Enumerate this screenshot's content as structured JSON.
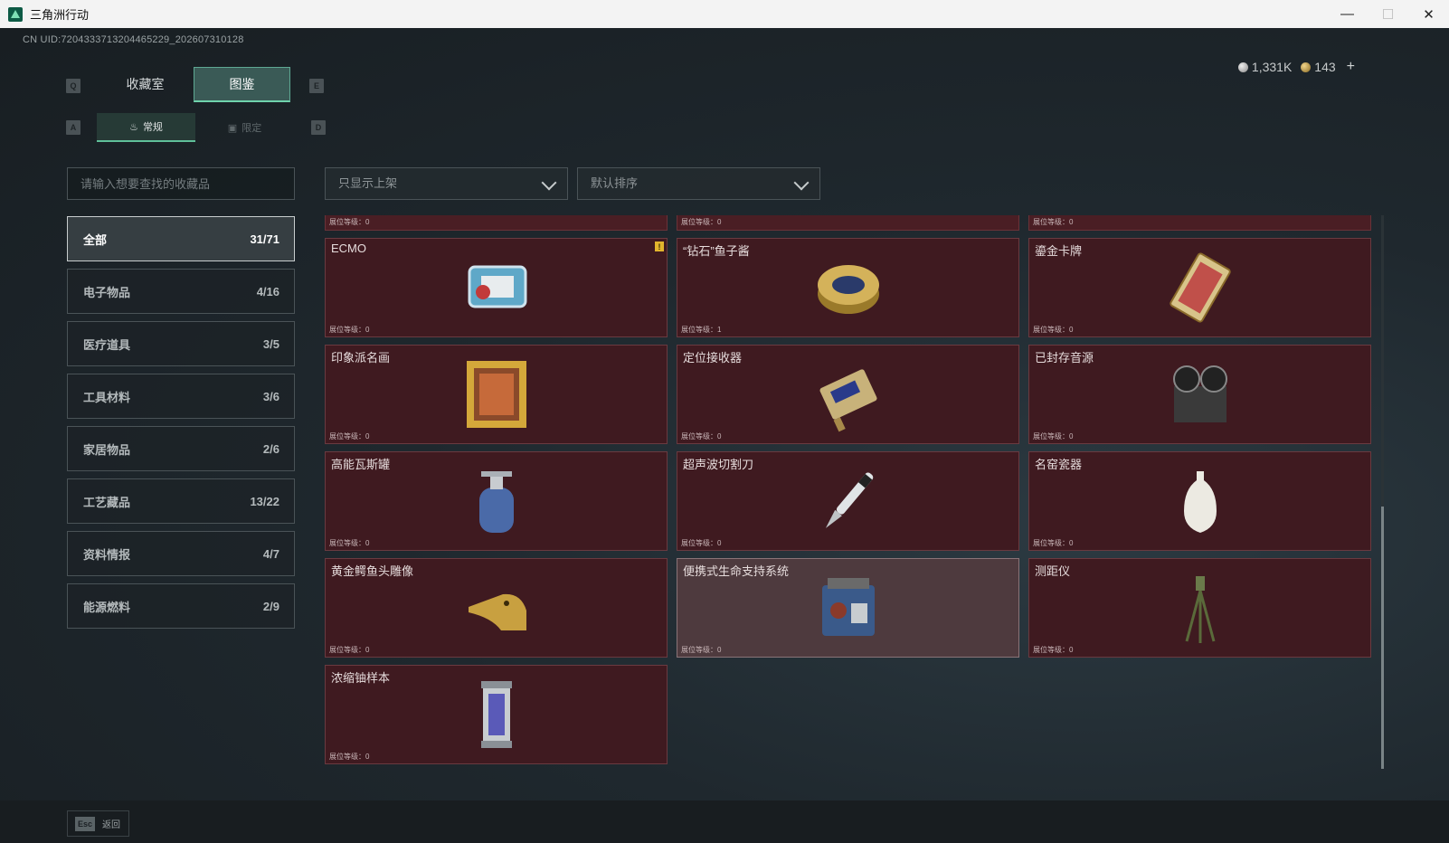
{
  "window": {
    "title": "三角洲行动",
    "controls": [
      "—",
      "☐",
      "✕"
    ]
  },
  "uid": "CN UID:7204333713204465229_202607310128",
  "currency": {
    "silver": "1,331K",
    "gold": "143",
    "plus": "+"
  },
  "keys": {
    "q": "Q",
    "e": "E",
    "a": "A",
    "d": "D"
  },
  "tabs": [
    {
      "label": "收藏室",
      "active": false
    },
    {
      "label": "图鉴",
      "active": true
    }
  ],
  "subtabs": [
    {
      "label": "常规",
      "icon": "flame-icon",
      "active": true
    },
    {
      "label": "限定",
      "icon": "frame-icon",
      "active": false
    }
  ],
  "search": {
    "placeholder": "请输入想要查找的收藏品",
    "value": ""
  },
  "filters": {
    "shelf": "只显示上架",
    "sort": "默认排序"
  },
  "categories": [
    {
      "label": "全部",
      "count": "31/71",
      "active": true
    },
    {
      "label": "电子物品",
      "count": "4/16"
    },
    {
      "label": "医疗道具",
      "count": "3/5"
    },
    {
      "label": "工具材料",
      "count": "3/6"
    },
    {
      "label": "家居物品",
      "count": "2/6"
    },
    {
      "label": "工艺藏品",
      "count": "13/22"
    },
    {
      "label": "资料情报",
      "count": "4/7"
    },
    {
      "label": "能源燃料",
      "count": "2/9"
    }
  ],
  "partial_row": [
    {
      "level": "展位等级：0"
    },
    {
      "level": "展位等级：0"
    },
    {
      "level": "展位等级：0"
    }
  ],
  "items": [
    {
      "name": "ECMO",
      "level": "展位等级：0",
      "icon": "ecmo-machine-icon",
      "badge": "!"
    },
    {
      "name": "“钻石”鱼子酱",
      "level": "展位等级：1",
      "icon": "caviar-tin-icon"
    },
    {
      "name": "鎏金卡牌",
      "level": "展位等级：0",
      "icon": "gilded-card-icon"
    },
    {
      "name": "印象派名画",
      "level": "展位等级：0",
      "icon": "framed-painting-icon"
    },
    {
      "name": "定位接收器",
      "level": "展位等级：0",
      "icon": "gps-receiver-icon"
    },
    {
      "name": "已封存音源",
      "level": "展位等级：0",
      "icon": "reel-recorder-icon"
    },
    {
      "name": "高能瓦斯罐",
      "level": "展位等级：0",
      "icon": "gas-canister-icon"
    },
    {
      "name": "超声波切割刀",
      "level": "展位等级：0",
      "icon": "ultrasonic-cutter-icon"
    },
    {
      "name": "名窑瓷器",
      "level": "展位等级：0",
      "icon": "porcelain-vase-icon"
    },
    {
      "name": "黄金鳄鱼头雕像",
      "level": "展位等级：0",
      "icon": "gold-crocodile-icon"
    },
    {
      "name": "便携式生命支持系统",
      "level": "展位等级：0",
      "icon": "life-support-icon",
      "highlight": true
    },
    {
      "name": "测距仪",
      "level": "展位等级：0",
      "icon": "rangefinder-icon"
    },
    {
      "name": "浓缩铀样本",
      "level": "展位等级：0",
      "icon": "uranium-canister-icon"
    }
  ],
  "footer": {
    "key": "Esc",
    "label": "返回"
  }
}
